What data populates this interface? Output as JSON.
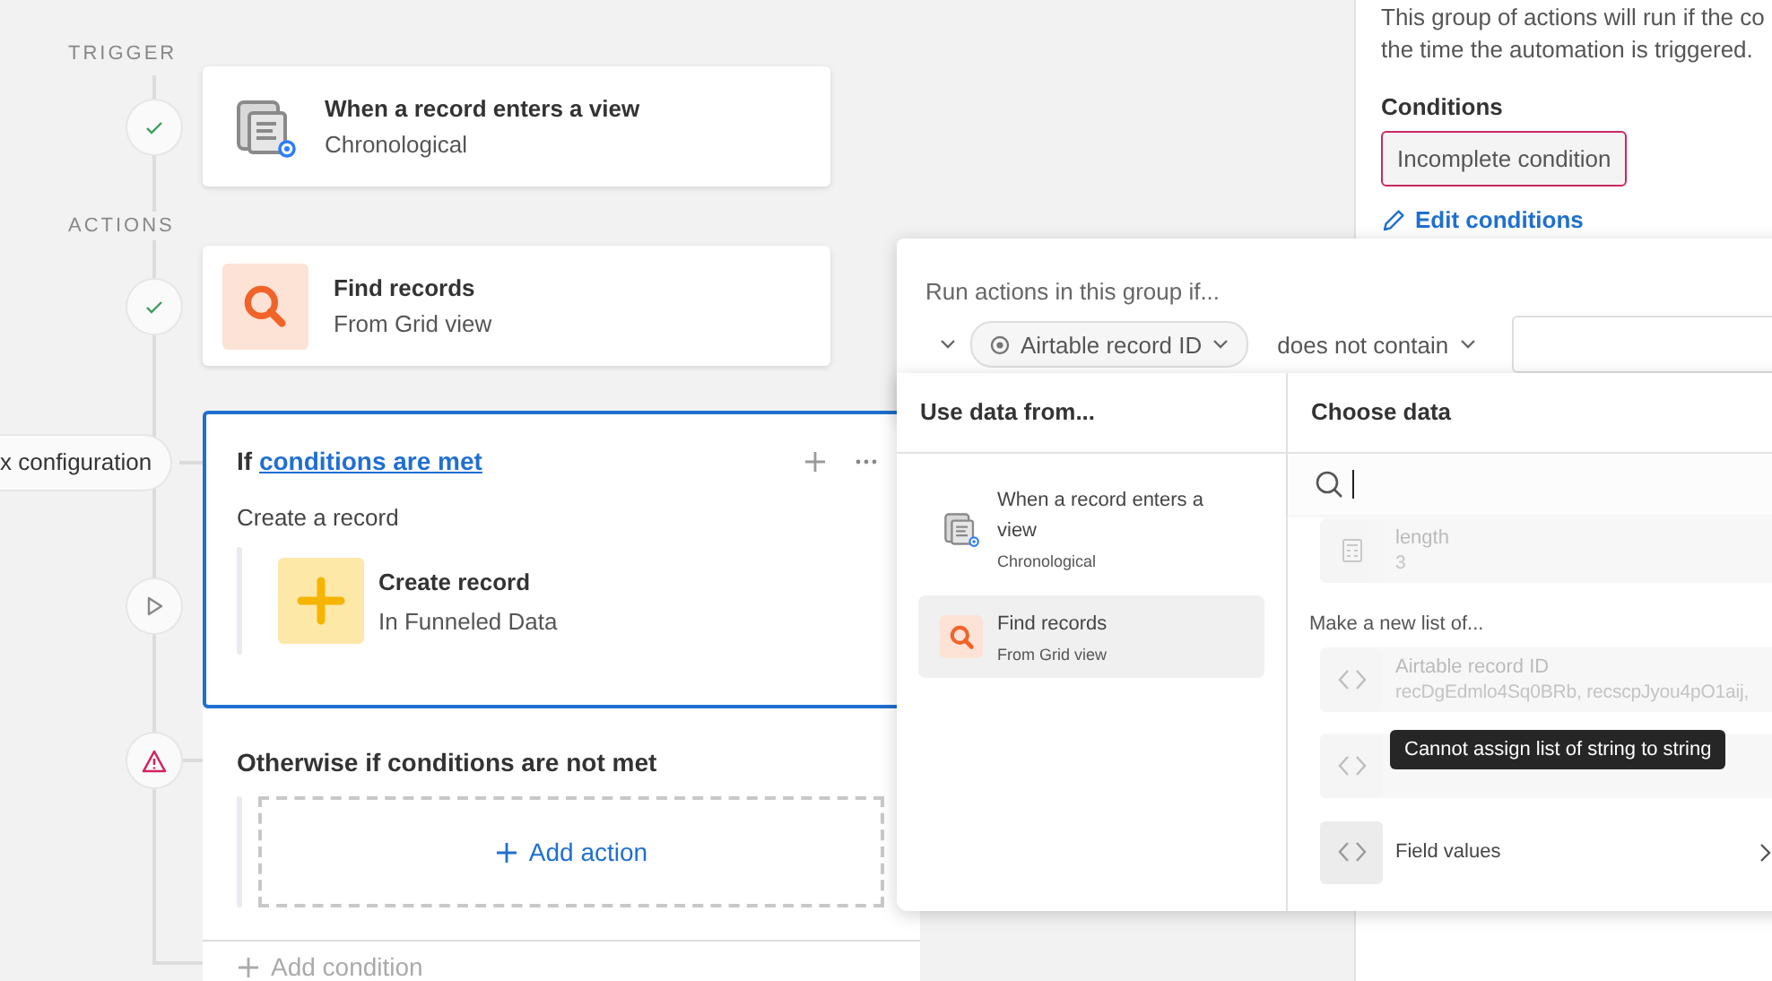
{
  "timeline": {
    "stages": [
      "TRIGGER",
      "ACTIONS"
    ]
  },
  "rail_nodes": [
    {
      "kind": "done"
    },
    {
      "kind": "done"
    },
    {
      "kind": "pending"
    },
    {
      "kind": "error"
    }
  ],
  "trigger": {
    "title": "When a record enters a view",
    "subtitle": "Chronological"
  },
  "action": {
    "title": "Find records",
    "subtitle": "From Grid view"
  },
  "branch_pill": "x configuration",
  "condition_group": {
    "prefix": "If",
    "link": "conditions are met",
    "selected": true,
    "description": "Create a record",
    "action": {
      "title": "Create record",
      "subtitle": "In Funneled Data"
    }
  },
  "otherwise": {
    "title": "Otherwise if conditions are not met",
    "add_action": "Add action"
  },
  "add_condition": "Add condition",
  "side_panel": {
    "description_lines": [
      "This group of actions will run if the co",
      "the time the automation is triggered."
    ],
    "conditions_label": "Conditions",
    "condition_chip": "Incomplete condition",
    "edit_link": "Edit conditions"
  },
  "condition_editor": {
    "prompt": "Run actions in this group if...",
    "field": "Airtable record ID",
    "operator": "does not contain"
  },
  "data_picker": {
    "sources_heading": "Use data from...",
    "data_heading": "Choose data",
    "sources": [
      {
        "title": "When a record enters a view",
        "subtitle": "Chronological",
        "kind": "table",
        "selected": false
      },
      {
        "title": "Find records",
        "subtitle": "From Grid view",
        "kind": "search",
        "selected": true
      }
    ],
    "items": [
      {
        "kind": "calculator",
        "title": "length",
        "value": "3",
        "disabled": true
      }
    ],
    "section_label": "Make a new list of...",
    "list_items": [
      {
        "kind": "code",
        "title": "Airtable record ID",
        "value": "recDgEdmlo4Sq0BRb, recscpJyou4pO1aij,",
        "disabled": true
      },
      {
        "kind": "code",
        "disabled": true
      },
      {
        "kind": "code",
        "title": "Field values",
        "disabled": false,
        "submenu": true
      }
    ],
    "tooltip": "Cannot assign list of string to string"
  }
}
